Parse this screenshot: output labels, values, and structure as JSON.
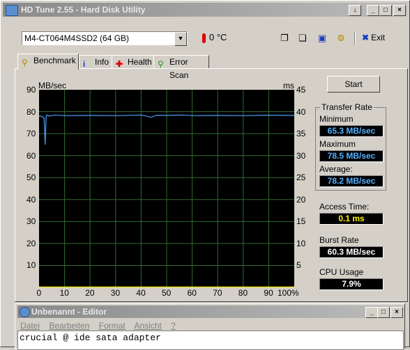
{
  "window": {
    "title": "HD Tune 2.55 - Hard Disk Utility",
    "controls": [
      "↓",
      "_",
      "□",
      "×"
    ]
  },
  "toolbar": {
    "drive": "M4-CT064M4SSD2 (64 GB)",
    "temperature": "0 °C",
    "exit_label": "Exit"
  },
  "tabs": [
    {
      "label": "Benchmark",
      "icon": "benchmark-icon",
      "active": true
    },
    {
      "label": "Info",
      "icon": "info-icon",
      "active": false
    },
    {
      "label": "Health",
      "icon": "health-icon",
      "active": false
    },
    {
      "label": "Error Scan",
      "icon": "error-scan-icon",
      "active": false
    }
  ],
  "graph": {
    "left_unit": "MB/sec",
    "right_unit": "ms",
    "left_ticks": [
      "90",
      "80",
      "70",
      "60",
      "50",
      "40",
      "30",
      "20",
      "10"
    ],
    "right_ticks": [
      "45",
      "40",
      "35",
      "30",
      "25",
      "20",
      "15",
      "10",
      "5"
    ],
    "x_ticks": [
      "0",
      "10",
      "20",
      "30",
      "40",
      "50",
      "60",
      "70",
      "80",
      "90",
      "100%"
    ]
  },
  "chart_data": {
    "type": "line",
    "ylim": [
      0,
      90
    ],
    "y2lim": [
      0,
      45
    ],
    "series": [
      {
        "color": "#4aa0ff",
        "x": [
          0,
          1,
          2,
          2.4,
          2.8,
          3,
          4,
          6,
          10,
          20,
          30,
          40,
          44,
          46,
          50,
          56,
          60,
          70,
          80,
          90,
          100
        ],
        "values": [
          78,
          78,
          77,
          65,
          78,
          78.5,
          78,
          78.5,
          78.2,
          78.3,
          78.2,
          78.5,
          77.5,
          78.4,
          78.3,
          78.5,
          78.2,
          78.3,
          78.2,
          78.4,
          78.3
        ]
      },
      {
        "color": "#e8e800",
        "x": [
          0,
          10,
          20,
          30,
          40,
          50,
          60,
          70,
          80,
          90,
          100
        ],
        "values": [
          0.1,
          0.1,
          0.1,
          0.1,
          0.1,
          0.1,
          0.1,
          0.1,
          0.1,
          0.1,
          0.1
        ]
      }
    ]
  },
  "side": {
    "start_label": "Start",
    "transfer_rate_title": "Transfer Rate",
    "minimum_label": "Minimum",
    "minimum_value": "65.3 MB/sec",
    "maximum_label": "Maximum",
    "maximum_value": "78.5 MB/sec",
    "average_label": "Average:",
    "average_value": "78.2 MB/sec",
    "access_label": "Access Time:",
    "access_value": "0.1 ms",
    "burst_label": "Burst Rate",
    "burst_value": "60.3 MB/sec",
    "cpu_label": "CPU Usage",
    "cpu_value": "7.9%"
  },
  "editor": {
    "title": "Unbenannt - Editor",
    "menu": [
      "Datei",
      "Bearbeiten",
      "Format",
      "Ansicht",
      "?"
    ],
    "content": "crucial @ ide sata adapter"
  }
}
